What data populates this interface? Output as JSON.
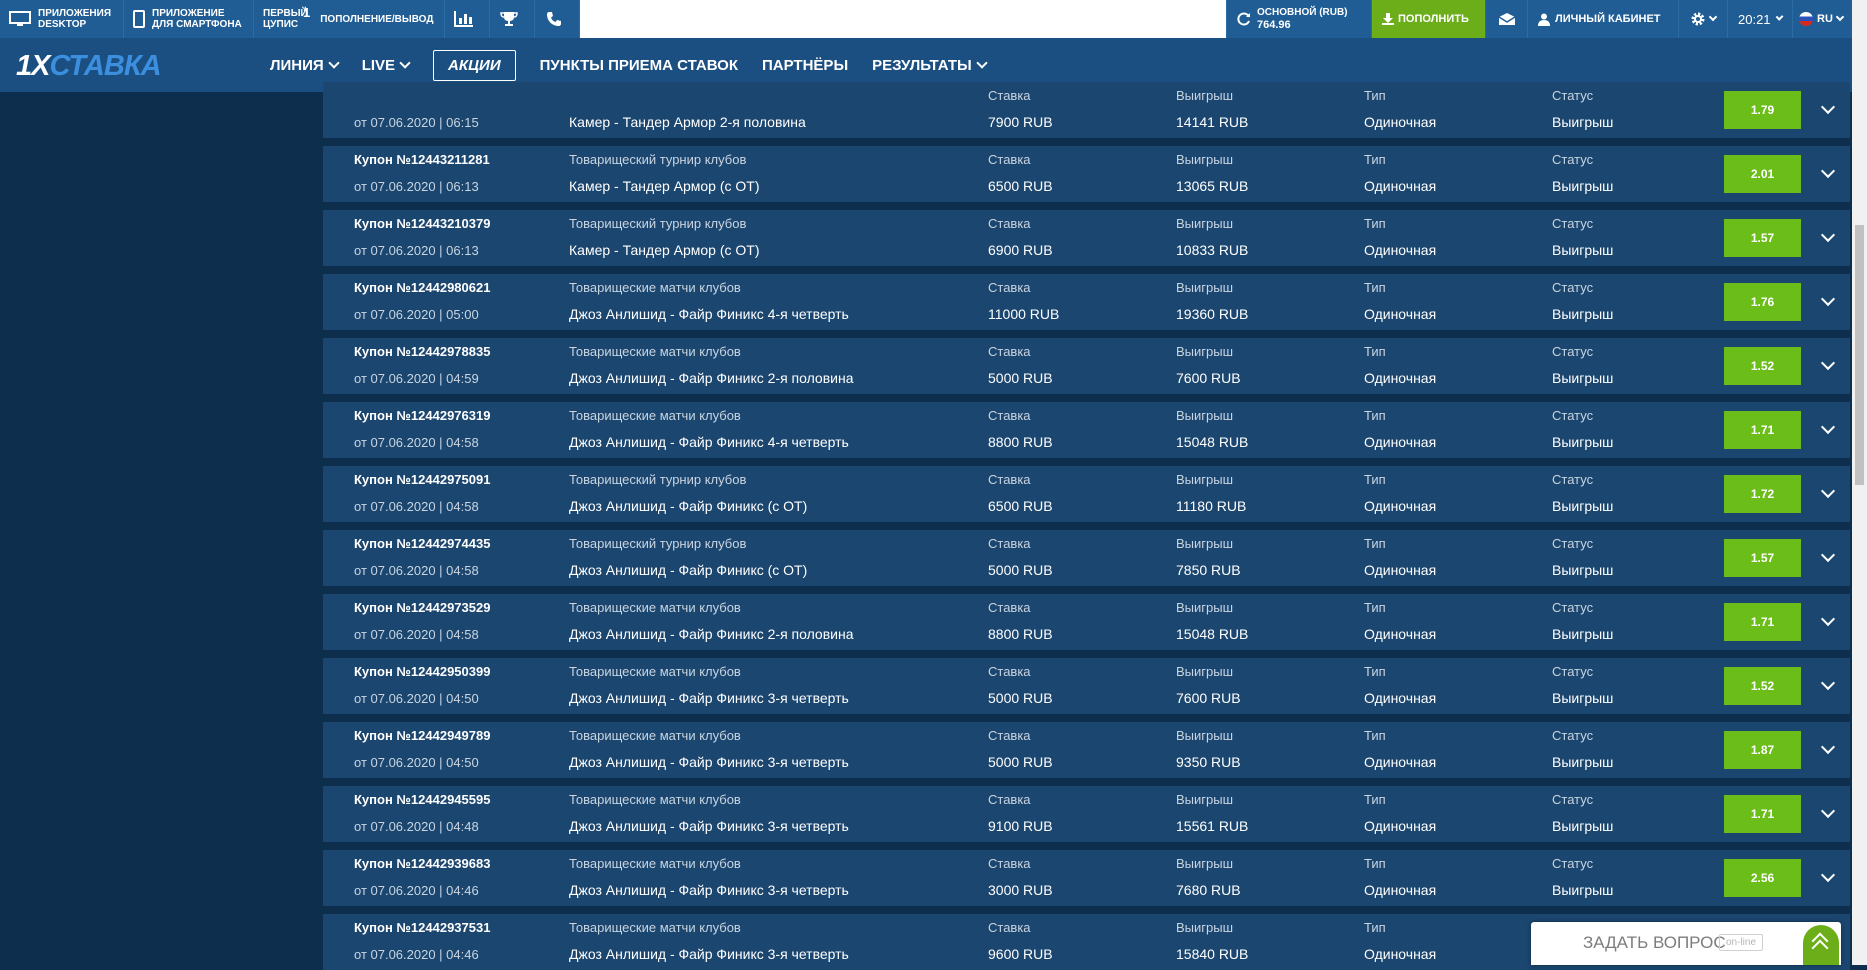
{
  "topbar": {
    "apps_desktop": "Приложения DESKTOP",
    "apps_mobile": "Приложение для смартфона",
    "first_cupis": "Первый ЦУПИС",
    "first_cupis_sup": "1",
    "deposit_withdraw": "Пополнение/Вывод",
    "balance_label": "Основной (RUB)",
    "balance_value": "764.96",
    "deposit_button": "Пополнить",
    "cabinet": "Личный кабинет",
    "time": "20:21",
    "lang": "RU"
  },
  "logo": {
    "part1": "1X",
    "part2": "СТАВКА"
  },
  "nav": {
    "line": "ЛИНИЯ",
    "live": "LIVE",
    "promos": "АКЦИИ",
    "points": "ПУНКТЫ ПРИЕМА СТАВОК",
    "partners": "ПАРТНЁРЫ",
    "results": "РЕЗУЛЬТАТЫ"
  },
  "labels": {
    "stake": "Ставка",
    "win": "Выигрыш",
    "type": "Тип",
    "status": "Статус"
  },
  "bets": [
    {
      "coupon": "",
      "date": "от 07.06.2020 | 06:15",
      "tournament": "",
      "event": "Камер - Тандер Армор 2-я половина",
      "stake": "7900 RUB",
      "win": "14141 RUB",
      "type": "Одиночная",
      "status": "Выигрыш",
      "odds": "1.79"
    },
    {
      "coupon": "Купон №12443211281",
      "date": "от 07.06.2020 | 06:13",
      "tournament": "Товарищеский турнир клубов",
      "event": "Камер - Тандер Армор (с ОТ)",
      "stake": "6500 RUB",
      "win": "13065 RUB",
      "type": "Одиночная",
      "status": "Выигрыш",
      "odds": "2.01"
    },
    {
      "coupon": "Купон №12443210379",
      "date": "от 07.06.2020 | 06:13",
      "tournament": "Товарищеский турнир клубов",
      "event": "Камер - Тандер Армор (с ОТ)",
      "stake": "6900 RUB",
      "win": "10833 RUB",
      "type": "Одиночная",
      "status": "Выигрыш",
      "odds": "1.57"
    },
    {
      "coupon": "Купон №12442980621",
      "date": "от 07.06.2020 | 05:00",
      "tournament": "Товарищеские матчи клубов",
      "event": "Джоз Анлишид - Файр Финикс 4-я четверть",
      "stake": "11000 RUB",
      "win": "19360 RUB",
      "type": "Одиночная",
      "status": "Выигрыш",
      "odds": "1.76"
    },
    {
      "coupon": "Купон №12442978835",
      "date": "от 07.06.2020 | 04:59",
      "tournament": "Товарищеские матчи клубов",
      "event": "Джоз Анлишид - Файр Финикс 2-я половина",
      "stake": "5000 RUB",
      "win": "7600 RUB",
      "type": "Одиночная",
      "status": "Выигрыш",
      "odds": "1.52"
    },
    {
      "coupon": "Купон №12442976319",
      "date": "от 07.06.2020 | 04:58",
      "tournament": "Товарищеские матчи клубов",
      "event": "Джоз Анлишид - Файр Финикс 4-я четверть",
      "stake": "8800 RUB",
      "win": "15048 RUB",
      "type": "Одиночная",
      "status": "Выигрыш",
      "odds": "1.71"
    },
    {
      "coupon": "Купон №12442975091",
      "date": "от 07.06.2020 | 04:58",
      "tournament": "Товарищеский турнир клубов",
      "event": "Джоз Анлишид - Файр Финикс (с ОТ)",
      "stake": "6500 RUB",
      "win": "11180 RUB",
      "type": "Одиночная",
      "status": "Выигрыш",
      "odds": "1.72"
    },
    {
      "coupon": "Купон №12442974435",
      "date": "от 07.06.2020 | 04:58",
      "tournament": "Товарищеский турнир клубов",
      "event": "Джоз Анлишид - Файр Финикс (с ОТ)",
      "stake": "5000 RUB",
      "win": "7850 RUB",
      "type": "Одиночная",
      "status": "Выигрыш",
      "odds": "1.57"
    },
    {
      "coupon": "Купон №12442973529",
      "date": "от 07.06.2020 | 04:58",
      "tournament": "Товарищеские матчи клубов",
      "event": "Джоз Анлишид - Файр Финикс 2-я половина",
      "stake": "8800 RUB",
      "win": "15048 RUB",
      "type": "Одиночная",
      "status": "Выигрыш",
      "odds": "1.71"
    },
    {
      "coupon": "Купон №12442950399",
      "date": "от 07.06.2020 | 04:50",
      "tournament": "Товарищеские матчи клубов",
      "event": "Джоз Анлишид - Файр Финикс 3-я четверть",
      "stake": "5000 RUB",
      "win": "7600 RUB",
      "type": "Одиночная",
      "status": "Выигрыш",
      "odds": "1.52"
    },
    {
      "coupon": "Купон №12442949789",
      "date": "от 07.06.2020 | 04:50",
      "tournament": "Товарищеские матчи клубов",
      "event": "Джоз Анлишид - Файр Финикс 3-я четверть",
      "stake": "5000 RUB",
      "win": "9350 RUB",
      "type": "Одиночная",
      "status": "Выигрыш",
      "odds": "1.87"
    },
    {
      "coupon": "Купон №12442945595",
      "date": "от 07.06.2020 | 04:48",
      "tournament": "Товарищеские матчи клубов",
      "event": "Джоз Анлишид - Файр Финикс 3-я четверть",
      "stake": "9100 RUB",
      "win": "15561 RUB",
      "type": "Одиночная",
      "status": "Выигрыш",
      "odds": "1.71"
    },
    {
      "coupon": "Купон №12442939683",
      "date": "от 07.06.2020 | 04:46",
      "tournament": "Товарищеские матчи клубов",
      "event": "Джоз Анлишид - Файр Финикс 3-я четверть",
      "stake": "3000 RUB",
      "win": "7680 RUB",
      "type": "Одиночная",
      "status": "Выигрыш",
      "odds": "2.56"
    },
    {
      "coupon": "Купон №12442937531",
      "date": "от 07.06.2020 | 04:46",
      "tournament": "Товарищеские матчи клубов",
      "event": "Джоз Анлишид - Файр Финикс 3-я четверть",
      "stake": "9600 RUB",
      "win": "15840 RUB",
      "type": "Одиночная",
      "status": "",
      "odds": ""
    }
  ],
  "ask": {
    "text": "ЗАДАТЬ ВОПРОС",
    "status": "on-line"
  },
  "colors": {
    "bg": "#0d2e4c",
    "row": "#1b466f",
    "header": "#1b4f82",
    "topbar": "#1f5d94",
    "accent_green": "#6bbd1a"
  }
}
